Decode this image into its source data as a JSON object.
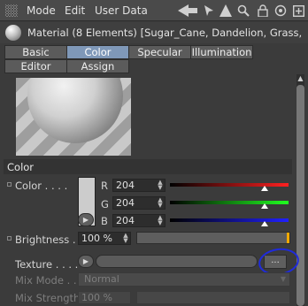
{
  "menubar": {
    "items": [
      "Mode",
      "Edit",
      "User Data"
    ],
    "icons": [
      "back-arrow-icon",
      "cursor-icon",
      "up-arrow-icon",
      "search-icon",
      "lock-icon",
      "target-icon",
      "new-window-icon"
    ]
  },
  "material": {
    "title": "Material (8 Elements) [Sugar_Cane, Dandelion, Grass, Gravel, S"
  },
  "tabs": {
    "row1": [
      "Basic",
      "Color",
      "Specular",
      "Illumination"
    ],
    "row2": [
      "Editor",
      "Assign"
    ],
    "active": "Color"
  },
  "section": {
    "title": "Color"
  },
  "color": {
    "label": "Color . . . .",
    "r_label": "R",
    "g_label": "G",
    "b_label": "B",
    "r": "204",
    "g": "204",
    "b": "204",
    "swatch": "#cccccc",
    "r_level": 0.8,
    "g_level": 0.8,
    "b_level": 0.8
  },
  "brightness": {
    "label": "Brightness . .",
    "value": "100 %"
  },
  "texture": {
    "label": "Texture . . . .",
    "button_label": "..."
  },
  "mix_mode": {
    "label": "Mix Mode . .",
    "value": "Normal"
  },
  "mix_strength": {
    "label": "Mix Strength",
    "value": "100 %"
  }
}
